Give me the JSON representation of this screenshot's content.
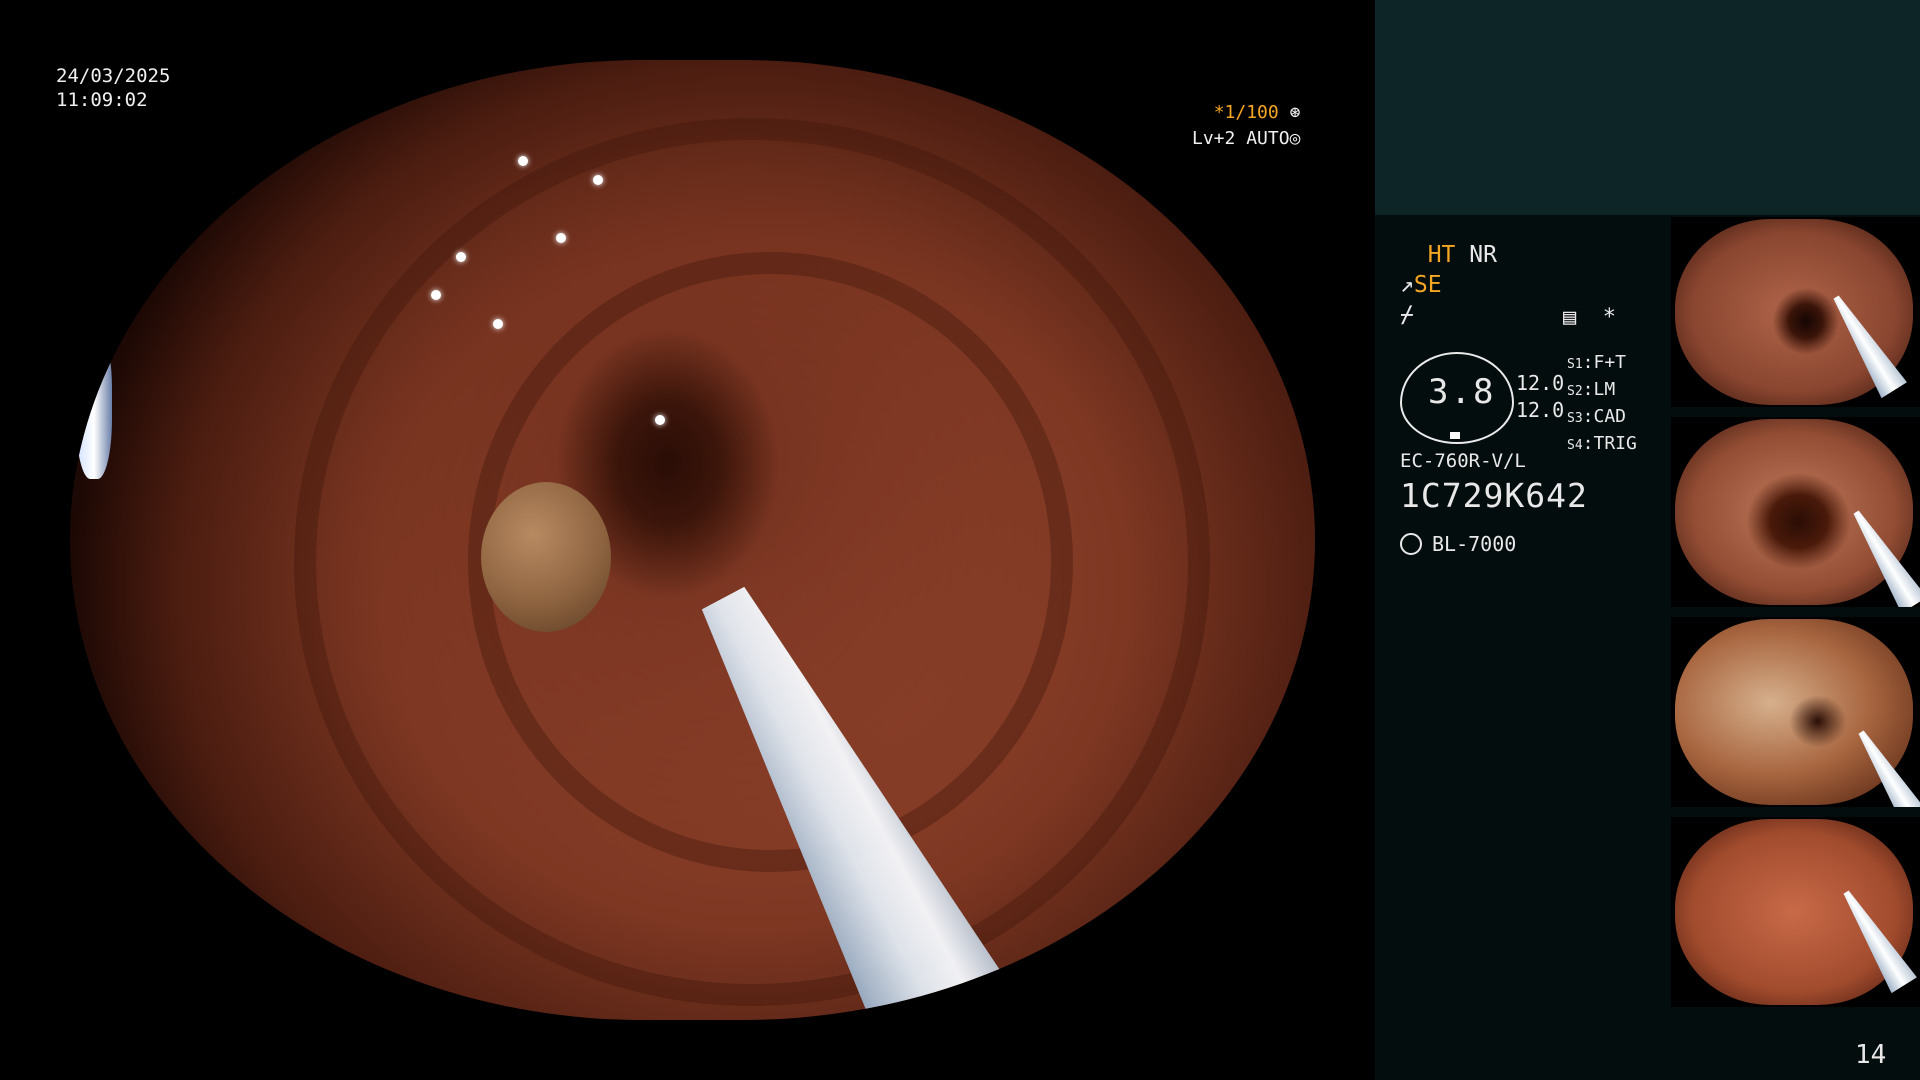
{
  "overlay": {
    "date": "24/03/2025",
    "time": "11:09:02",
    "shutter": "*1/100",
    "level": "Lv+2",
    "mode": "AUTO"
  },
  "panel": {
    "ht": "HT",
    "nr": "NR",
    "se": "SE",
    "star": "*",
    "gauge_value": "3.8",
    "gauge_levels": [
      "12.0",
      "12.0"
    ],
    "modes": [
      {
        "key": "S1",
        "value": "F+T"
      },
      {
        "key": "S2",
        "value": "LM"
      },
      {
        "key": "S3",
        "value": "CAD"
      },
      {
        "key": "S4",
        "value": "TRIG"
      }
    ],
    "scope_model": "EC-760R-V/L",
    "scope_serial": "1C729K642",
    "light_source": "BL-7000"
  },
  "page_number": "14",
  "colors": {
    "accent": "#f5a623",
    "panel_top": "#0e2527",
    "panel": "#040d0e"
  }
}
